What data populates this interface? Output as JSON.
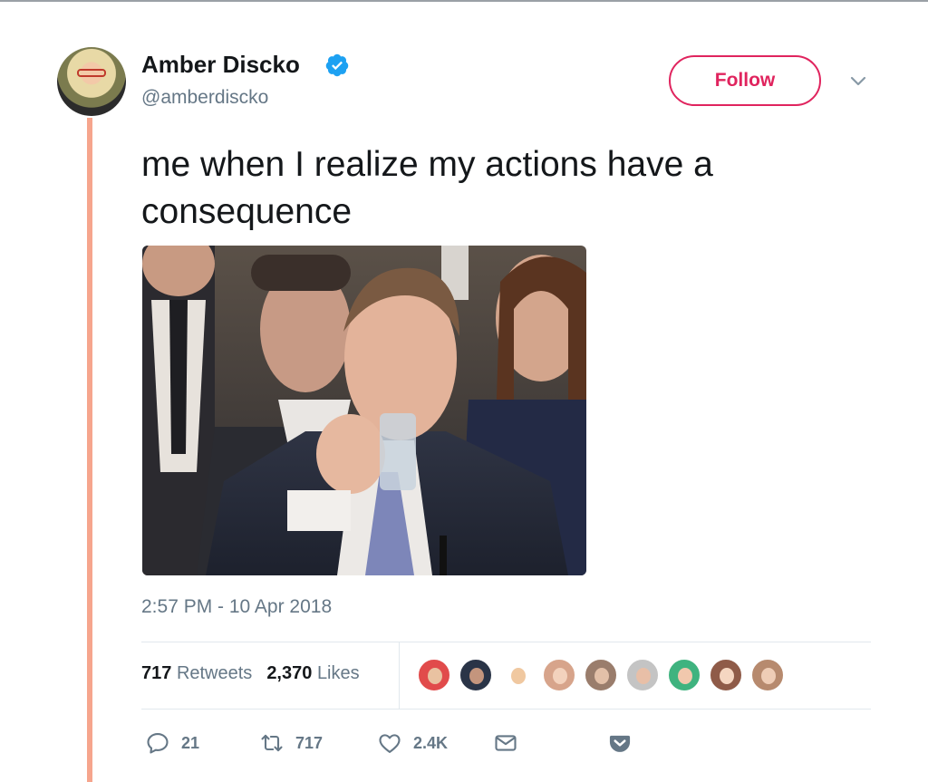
{
  "author": {
    "name": "Amber Discko",
    "handle": "@amberdiscko",
    "verified": true
  },
  "follow_button": {
    "label": "Follow"
  },
  "tweet": {
    "text": "me when I realize my actions have a consequence",
    "timestamp": "2:57 PM - 10 Apr 2018"
  },
  "stats": {
    "retweets_count": "717",
    "retweets_label": "Retweets",
    "likes_count": "2,370",
    "likes_label": "Likes",
    "liker_avatars": 9
  },
  "actions": {
    "reply_count": "21",
    "retweet_count": "717",
    "like_count": "2.4K"
  },
  "icons": {
    "verified": "verified-badge-icon",
    "caret": "chevron-down-icon",
    "reply": "reply-icon",
    "retweet": "retweet-icon",
    "like": "heart-icon",
    "message": "envelope-icon",
    "pocket": "pocket-icon"
  },
  "colors": {
    "accent_follow": "#e0245e",
    "verified_blue": "#1da1f2",
    "thread_line": "#f6a58d",
    "secondary_text": "#657786",
    "pocket_icon": "#657786"
  }
}
